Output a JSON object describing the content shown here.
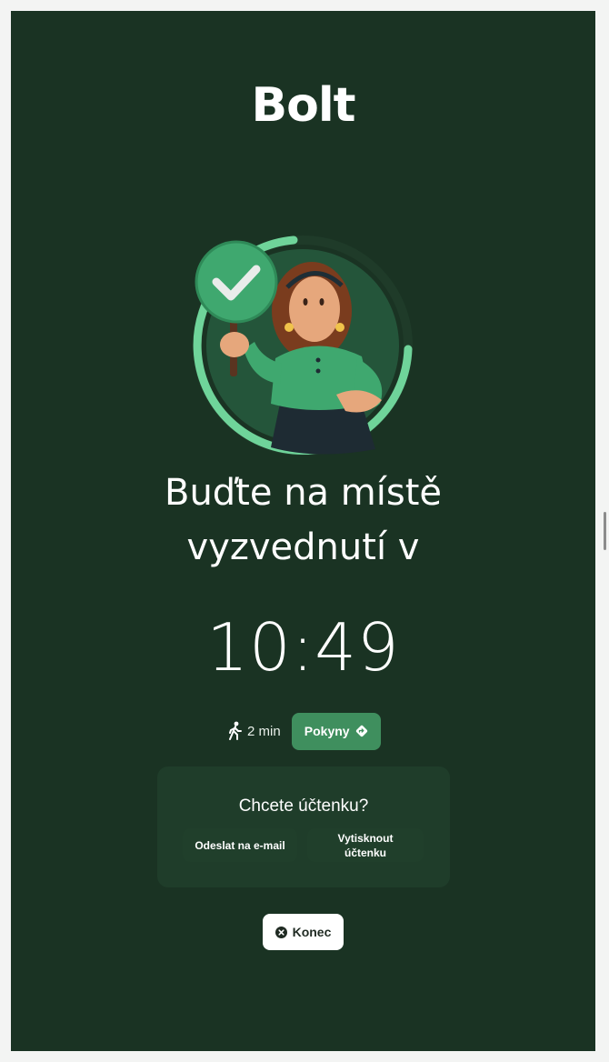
{
  "brand": {
    "logo_text": "Bolt"
  },
  "pickup": {
    "title_line1": "Buďte na místě",
    "title_line2": "vyzvednutí v",
    "time": "10:49",
    "walk_time": "2 min",
    "directions_label": "Pokyny"
  },
  "receipt": {
    "question": "Chcete účtenku?",
    "email_label": "Odeslat na e-mail",
    "print_label": "Vytisknout\núčtenku"
  },
  "footer": {
    "end_label": "Konec"
  },
  "icons": {
    "walk": "person-walking-icon",
    "directions": "directions-diamond-icon",
    "close": "close-circle-icon",
    "check": "check-icon"
  },
  "colors": {
    "background": "#1a3323",
    "accent": "#3f8f5e",
    "ring": "#6fd49a",
    "card": "#1f3d2a"
  }
}
